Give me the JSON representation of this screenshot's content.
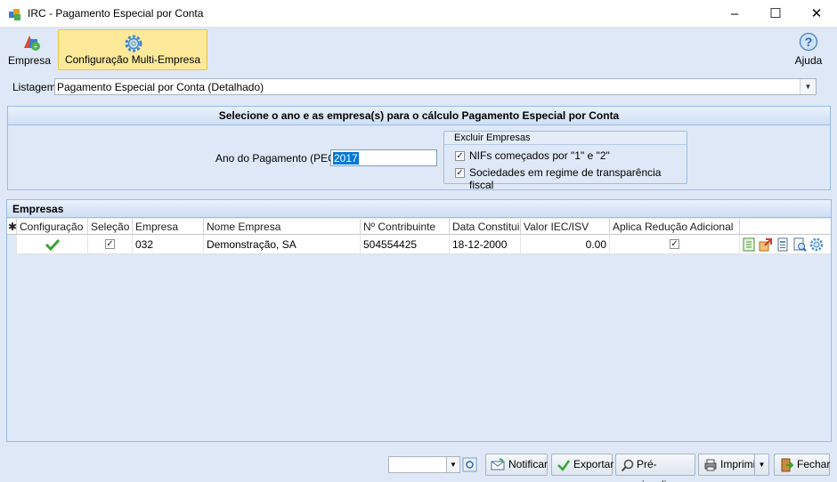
{
  "window": {
    "title": "IRC - Pagamento Especial por Conta"
  },
  "toolbar": {
    "empresa_label": "Empresa",
    "config_label": "Configuração Multi-Empresa",
    "ajuda_label": "Ajuda"
  },
  "listagem": {
    "label": "Listagem:",
    "value": "Pagamento Especial por Conta (Detalhado)"
  },
  "selection_panel": {
    "header": "Selecione o ano e as empresa(s) para o cálculo Pagamento Especial por Conta",
    "ano_label": "Ano do Pagamento (PEC):",
    "ano_value": "2017",
    "excluir": {
      "title": "Excluir Empresas",
      "nifs_label": "NIFs começados por \"1\" e \"2\"",
      "nifs_checked": true,
      "sociedades_label": "Sociedades em regime de transparência fiscal",
      "sociedades_checked": true
    }
  },
  "empresas": {
    "header": "Empresas",
    "columns": [
      "Configuração",
      "Seleção",
      "Empresa",
      "Nome Empresa",
      "Nº Contribuinte",
      "Data Constituição",
      "Valor IEC/ISV",
      "Aplica Redução Adicional"
    ],
    "rows": [
      {
        "configuracao": "ok",
        "selecao": true,
        "empresa": "032",
        "nome": "Demonstração, SA",
        "contribuinte": "504554425",
        "data": "18-12-2000",
        "valor": "0.00",
        "aplica": true
      }
    ],
    "row_icons": [
      "sheet-icon",
      "export-icon",
      "document-icon",
      "preview-icon",
      "gear-icon"
    ]
  },
  "bottombar": {
    "combo_value": "",
    "notificar": "Notificar",
    "exportar": "Exportar",
    "previsualizar": "Pré-visualizar",
    "imprimir": "Imprimir",
    "fechar": "Fechar"
  },
  "colors": {
    "accent": "#99bbe8",
    "panel": "#dfe8f6",
    "highlight": "#fde99a"
  }
}
